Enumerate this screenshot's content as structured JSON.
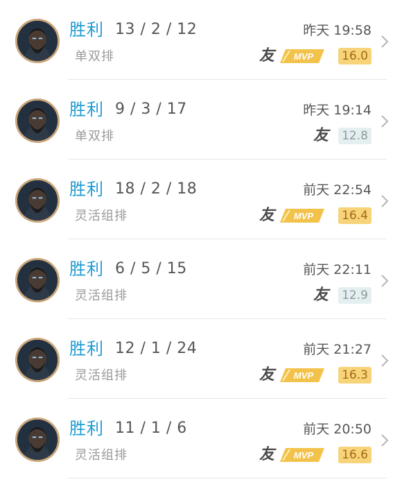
{
  "matches": [
    {
      "result": "胜利",
      "kda": "13 / 2 / 12",
      "mode": "单双排",
      "time": "昨天 19:58",
      "friend_badge": "友",
      "mvp": true,
      "mvp_label": "MVP",
      "score": "16.0",
      "score_style": "gold"
    },
    {
      "result": "胜利",
      "kda": "9 / 3 / 17",
      "mode": "单双排",
      "time": "昨天 19:14",
      "friend_badge": "友",
      "mvp": false,
      "score": "12.8",
      "score_style": "grey"
    },
    {
      "result": "胜利",
      "kda": "18 / 2 / 18",
      "mode": "灵活组排",
      "time": "前天 22:54",
      "friend_badge": "友",
      "mvp": true,
      "mvp_label": "MVP",
      "score": "16.4",
      "score_style": "gold"
    },
    {
      "result": "胜利",
      "kda": "6 / 5 / 15",
      "mode": "灵活组排",
      "time": "前天 22:11",
      "friend_badge": "友",
      "mvp": false,
      "score": "12.9",
      "score_style": "grey"
    },
    {
      "result": "胜利",
      "kda": "12 / 1 / 24",
      "mode": "灵活组排",
      "time": "前天 21:27",
      "friend_badge": "友",
      "mvp": true,
      "mvp_label": "MVP",
      "score": "16.3",
      "score_style": "gold"
    },
    {
      "result": "胜利",
      "kda": "11 / 1 / 6",
      "mode": "灵活组排",
      "time": "前天 20:50",
      "friend_badge": "友",
      "mvp": true,
      "mvp_label": "MVP",
      "score": "16.6",
      "score_style": "gold"
    }
  ],
  "colors": {
    "result_blue": "#1f9bd1",
    "gold_badge_bg": "#f7d37a",
    "gold_badge_text": "#a46a10",
    "grey_badge_bg": "#e6efef",
    "grey_badge_text": "#8a9aa0",
    "avatar_ring": "#c9a57a"
  },
  "icons": {
    "avatar": "hero-portrait-icon",
    "chevron": "chevron-right-icon",
    "mvp": "mvp-badge-icon"
  }
}
